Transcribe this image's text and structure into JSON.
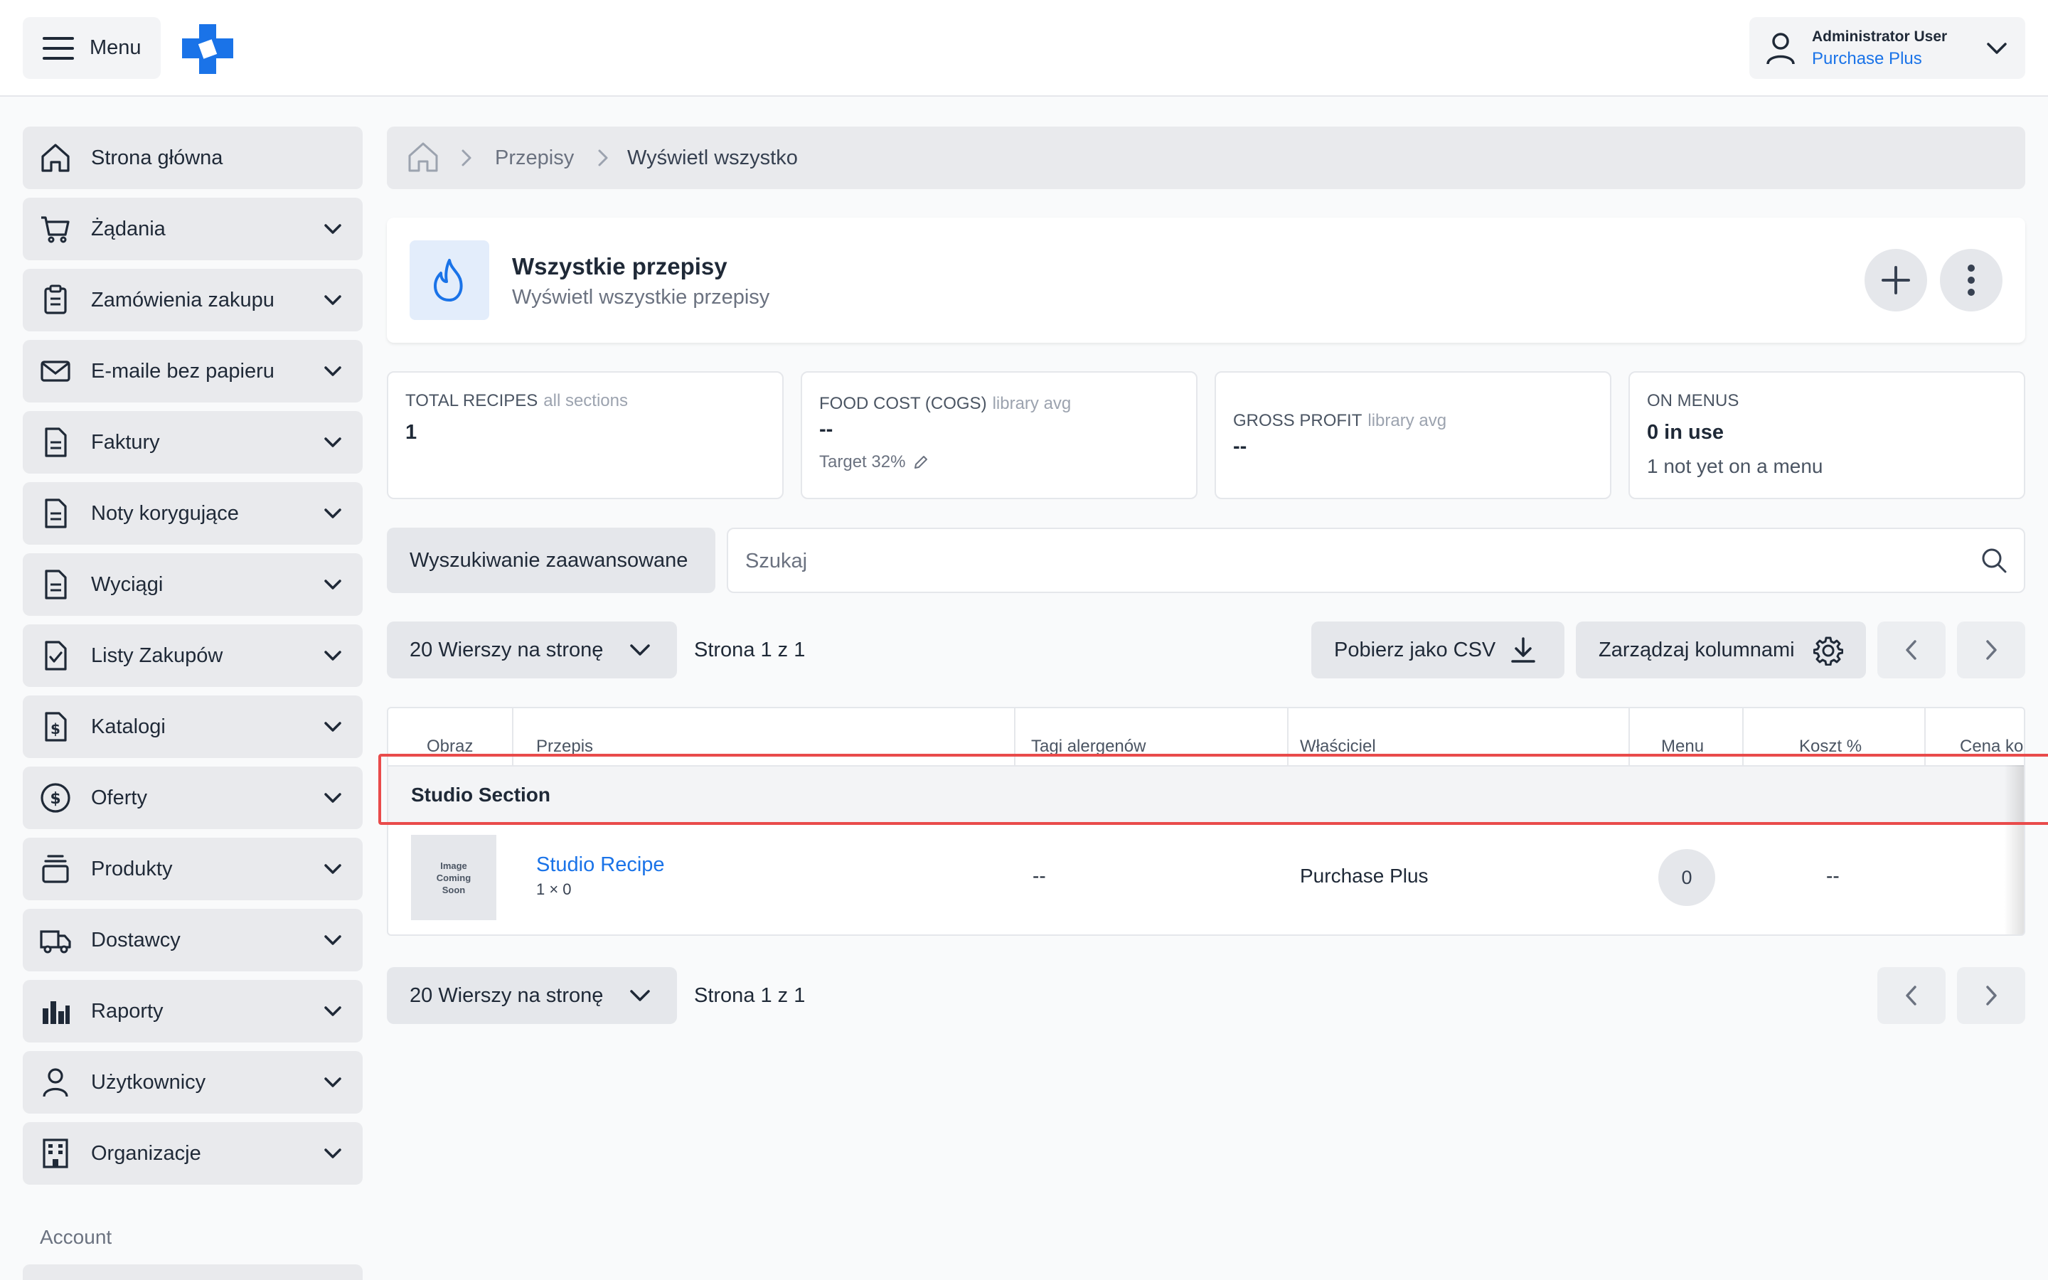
{
  "header": {
    "menu_label": "Menu",
    "user_name": "Administrator User",
    "user_org": "Purchase Plus"
  },
  "sidebar": {
    "items": [
      {
        "label": "Strona główna",
        "icon": "home-icon"
      },
      {
        "label": "Żądania",
        "icon": "cart-icon"
      },
      {
        "label": "Zamówienia zakupu",
        "icon": "clipboard-icon"
      },
      {
        "label": "E-maile bez papieru",
        "icon": "mail-icon"
      },
      {
        "label": "Faktury",
        "icon": "document-icon"
      },
      {
        "label": "Noty korygujące",
        "icon": "document-icon"
      },
      {
        "label": "Wyciągi",
        "icon": "document-icon"
      },
      {
        "label": "Listy Zakupów",
        "icon": "checklist-icon"
      },
      {
        "label": "Katalogi",
        "icon": "dollar-document-icon"
      },
      {
        "label": "Oferty",
        "icon": "dollar-circle-icon"
      },
      {
        "label": "Produkty",
        "icon": "stack-icon"
      },
      {
        "label": "Dostawcy",
        "icon": "truck-icon"
      },
      {
        "label": "Raporty",
        "icon": "bar-chart-icon"
      },
      {
        "label": "Użytkownicy",
        "icon": "user-icon"
      },
      {
        "label": "Organizacje",
        "icon": "building-icon"
      }
    ],
    "account_label": "Account"
  },
  "breadcrumb": {
    "link": "Przepisy",
    "current": "Wyświetl wszystko"
  },
  "title_card": {
    "title": "Wszystkie przepisy",
    "subtitle": "Wyświetl wszystkie przepisy"
  },
  "stats": {
    "total": {
      "label": "TOTAL RECIPES",
      "muted": "all sections",
      "value": "1"
    },
    "food_cost": {
      "label": "FOOD COST (COGS)",
      "muted": "library avg",
      "value": "--",
      "target": "Target 32%"
    },
    "gross_profit": {
      "label": "GROSS PROFIT",
      "muted": "library avg",
      "value": "--"
    },
    "on_menus": {
      "label": "ON MENUS",
      "value": "0 in use",
      "sub": "1 not yet on a menu"
    }
  },
  "search": {
    "advanced_label": "Wyszukiwanie zaawansowane",
    "placeholder": "Szukaj"
  },
  "controls": {
    "rows_label": "20 Wierszy na stronę",
    "page_info": "Strona 1 z 1",
    "csv_label": "Pobierz jako CSV",
    "columns_label": "Zarządzaj kolumnami"
  },
  "table": {
    "columns": [
      "Obraz",
      "Przepis",
      "Tagi alergenów",
      "Właściciel",
      "Menu",
      "Koszt %",
      "Cena ko"
    ],
    "section": "Studio Section",
    "rows": [
      {
        "image_text": [
          "Image",
          "Coming",
          "Soon"
        ],
        "recipe": "Studio Recipe",
        "recipe_sub": "1 × 0",
        "allergens": "--",
        "owner": "Purchase Plus",
        "menu": "0",
        "cost_pct": "--"
      }
    ]
  },
  "colors": {
    "accent": "#1a73e8",
    "highlight": "#e94b4b",
    "nav_bg": "#e9eaed"
  }
}
